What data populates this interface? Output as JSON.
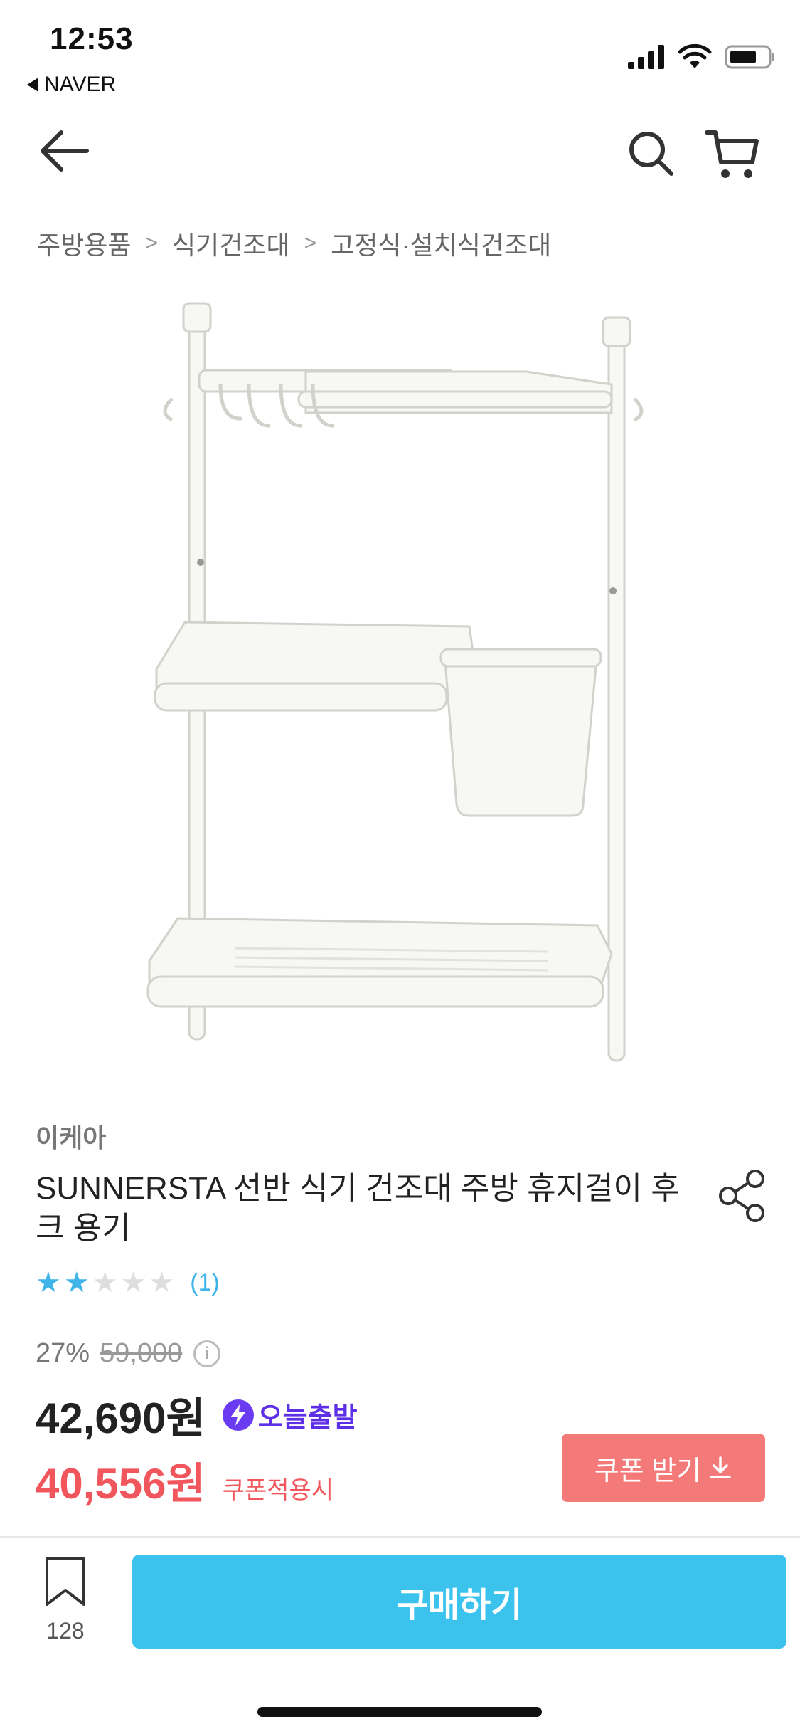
{
  "status_bar": {
    "time": "12:53",
    "back_app": "NAVER"
  },
  "breadcrumb": {
    "items": [
      "주방용품",
      "식기건조대",
      "고정식·설치식건조대"
    ]
  },
  "product": {
    "brand": "이케아",
    "title": "SUNNERSTA 선반 식기 건조대 주방 휴지걸이 후크 용기",
    "rating": {
      "stars_filled": 2,
      "stars_total": 5,
      "review_count": "(1)"
    },
    "discount_percent": "27%",
    "original_price": "59,000",
    "price": "42,690원",
    "today_badge": "오늘출발",
    "coupon_price": "40,556원",
    "coupon_note": "쿠폰적용시",
    "coupon_button": "쿠폰 받기"
  },
  "bottom_bar": {
    "bookmark_count": "128",
    "buy_label": "구매하기"
  },
  "colors": {
    "accent_blue": "#3bc3ee",
    "coupon_red": "#f0565b",
    "coupon_button": "#f47a7a",
    "badge_purple": "#5d2fe6"
  }
}
